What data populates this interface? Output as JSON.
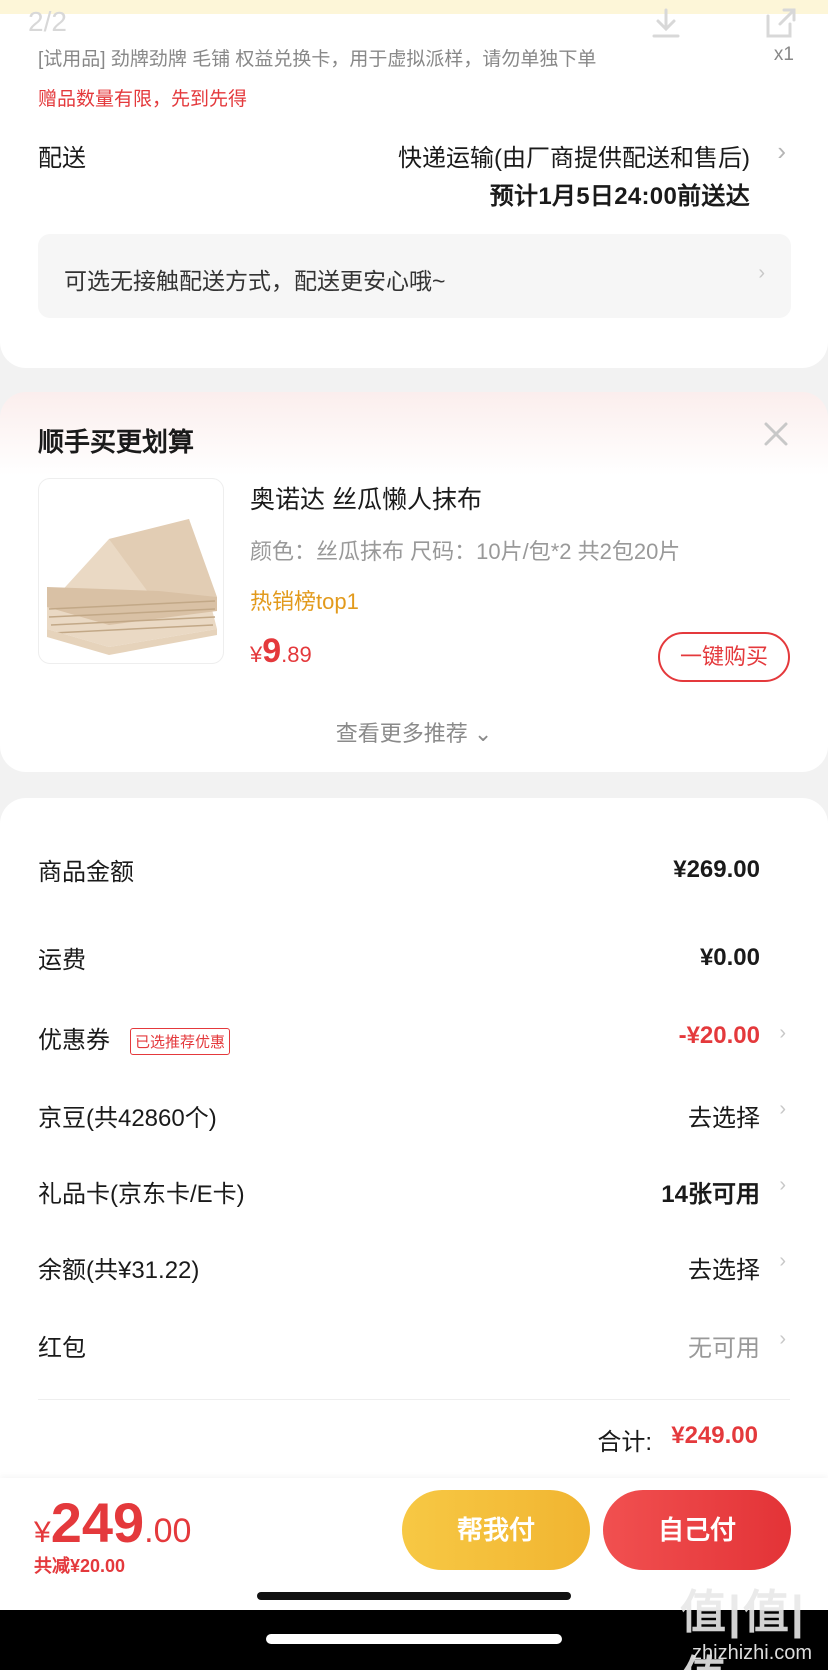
{
  "header": {
    "page_indicator": "2/2",
    "download_icon": "download-icon",
    "share_icon": "share-icon"
  },
  "order_item": {
    "trial_label": "[试用品]  劲牌劲牌 毛铺 权益兑换卡，用于虚拟派样，请勿单独下单",
    "quantity": "x1",
    "gift_note": "赠品数量有限，先到先得"
  },
  "delivery": {
    "label": "配送",
    "method": "快递运输(由厂商提供配送和售后)",
    "eta": "预计1月5日24:00前送达",
    "contactless_text": "可选无接触配送方式，配送更安心哦~"
  },
  "recommend": {
    "title": "顺手买更划算",
    "product_name": "奥诺达 丝瓜懒人抹布",
    "product_spec": "颜色：丝瓜抹布   尺码：10片/包*2 共2包20片",
    "rank_tag": "热销榜top1",
    "price_yen": "¥",
    "price_int": "9",
    "price_dec": ".89",
    "buy_label": "一键购买",
    "more_label": "查看更多推荐 ⌄"
  },
  "summary": {
    "rows": [
      {
        "label": "商品金额",
        "value": "¥269.00"
      },
      {
        "label": "运费",
        "value": "¥0.00"
      },
      {
        "label": "优惠券",
        "value": "-¥20.00",
        "tag": "已选推荐优惠"
      },
      {
        "label": "京豆(共42860个)",
        "value": "去选择"
      },
      {
        "label": "礼品卡(京东卡/E卡)",
        "value": "14张可用"
      },
      {
        "label": "余额(共¥31.22)",
        "value": "去选择"
      },
      {
        "label": "红包",
        "value": "无可用"
      }
    ],
    "total_label": "合计:",
    "total_value": "¥249.00"
  },
  "payment": {
    "yen": "¥",
    "amount_int": "249",
    "amount_dec": ".00",
    "saved": "共减¥20.00",
    "help_pay": "帮我付",
    "self_pay": "自己付"
  },
  "watermark": {
    "logo": "值|值|值",
    "url": "zhizhizhi.com"
  },
  "colors": {
    "accent_red": "#e4393c",
    "accent_yellow": "#f7c844",
    "rank_orange": "#e29a1c"
  }
}
